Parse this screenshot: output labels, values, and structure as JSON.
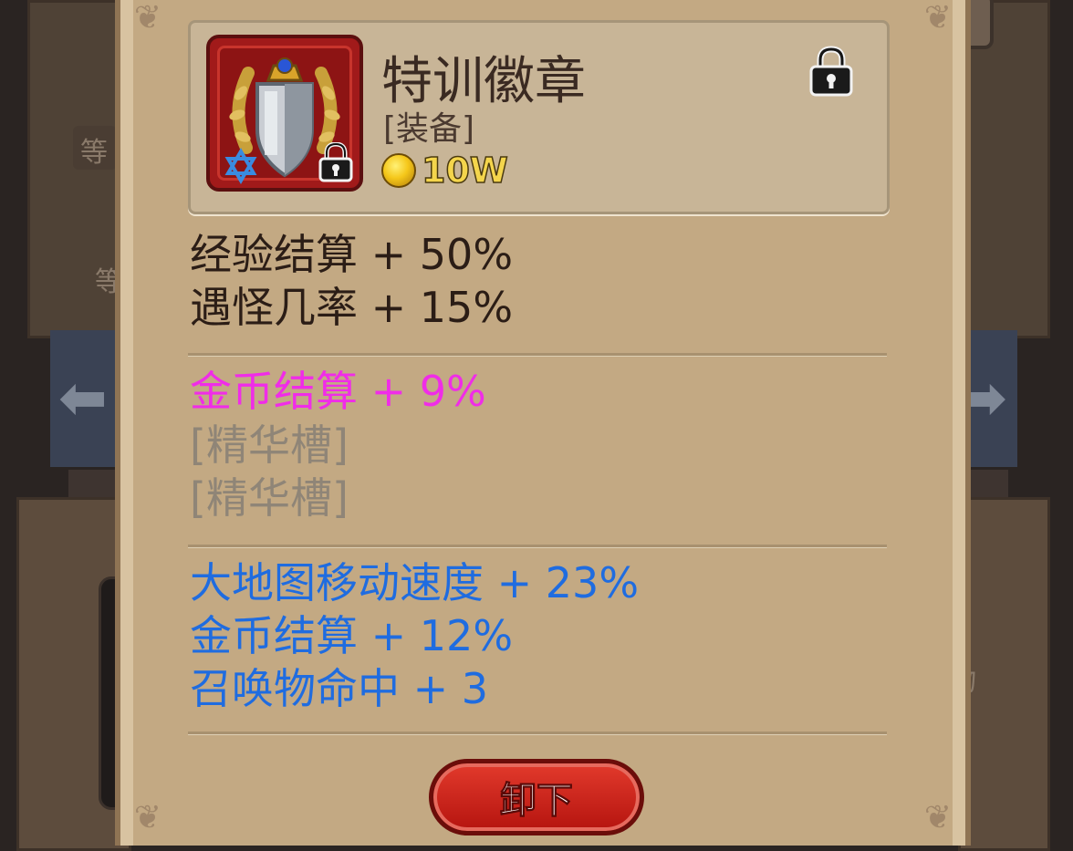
{
  "colors": {
    "panel": "#c3a983",
    "base_stat": "#2b1d16",
    "pink_stat": "#f02ce8",
    "slot_stat": "#8f8577",
    "blue_stat": "#1f6ce0",
    "button": "#d6261c"
  },
  "background": {
    "left_label_1": "等",
    "left_label_2": "等",
    "right_label": "物"
  },
  "item": {
    "name": "特训徽章",
    "type": "[装备]",
    "price": "10W",
    "icon": "shield-laurel-badge-icon",
    "locked": true
  },
  "stats": {
    "base": [
      "经验结算 + 50%",
      "遇怪几率 + 15%"
    ],
    "special": [
      "金币结算 + 9%"
    ],
    "slots": [
      "[精华槽]",
      "[精华槽]"
    ],
    "bonus": [
      "大地图移动速度 + 23%",
      "金币结算 + 12%",
      "召唤物命中 + 3"
    ]
  },
  "buttons": {
    "unequip": "卸下"
  }
}
